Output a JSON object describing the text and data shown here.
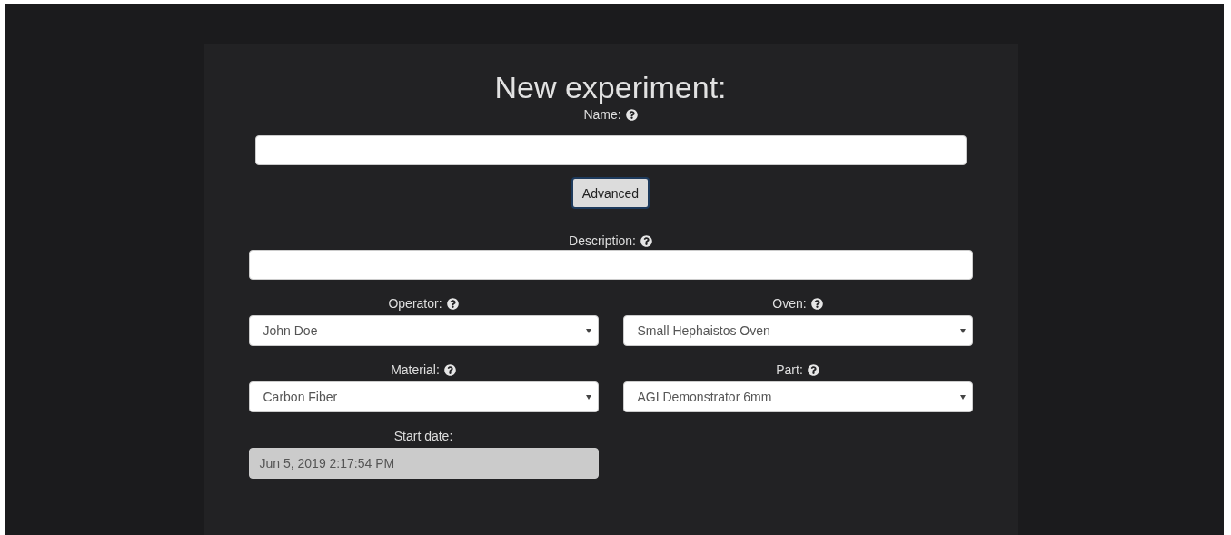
{
  "form": {
    "title": "New experiment:",
    "name": {
      "label": "Name:",
      "help": true
    },
    "advanced_button": "Advanced",
    "description": {
      "label": "Description:",
      "help": true
    },
    "grid": [
      {
        "kind": "select",
        "label": "Operator:",
        "help": true,
        "value": "John Doe"
      },
      {
        "kind": "select",
        "label": "Oven:",
        "help": true,
        "value": "Small Hephaistos Oven"
      },
      {
        "kind": "select",
        "label": "Material:",
        "help": true,
        "value": "Carbon Fiber"
      },
      {
        "kind": "select",
        "label": "Part:",
        "help": true,
        "value": "AGI Demonstrator 6mm"
      },
      {
        "kind": "readonly",
        "label": "Start date:",
        "help": false,
        "value": "Jun 5, 2019 2:17:54 PM",
        "disabled": true
      }
    ]
  }
}
